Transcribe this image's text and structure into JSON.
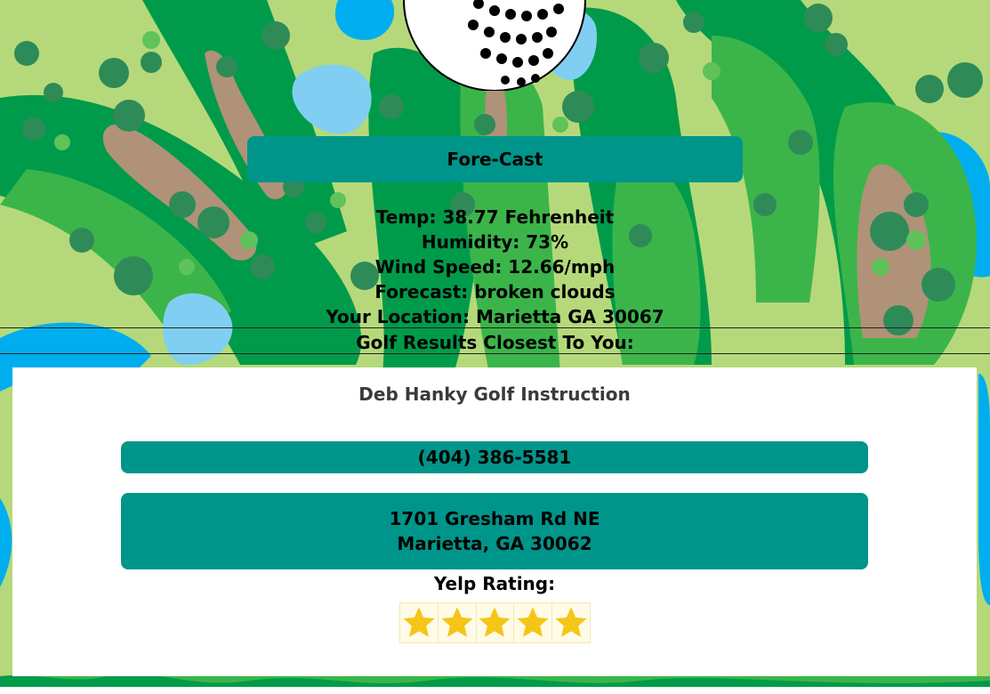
{
  "app": {
    "title": "Fore-Cast"
  },
  "weather": {
    "temp": "Temp: 38.77 Fehrenheit",
    "humidity": "Humidity: 73%",
    "wind": "Wind Speed: 12.66/mph",
    "forecast": "Forecast: broken clouds",
    "location": "Your Location: Marietta GA 30067",
    "results_heading": "Golf Results Closest To You:"
  },
  "result": {
    "name": "Deb Hanky Golf Instruction",
    "phone": "(404) 386-5581",
    "address_line1": "1701 Gresham Rd NE",
    "address_line2": "Marietta, GA 30062",
    "rating_label": "Yelp Rating:",
    "rating_stars": 5,
    "rating_max": 5
  },
  "colors": {
    "accent": "#00958a",
    "card_bg": "#ffffff",
    "star": "#f5c518"
  },
  "icons": {
    "logo": "golf-ball-icon",
    "rating": "star-icon"
  }
}
